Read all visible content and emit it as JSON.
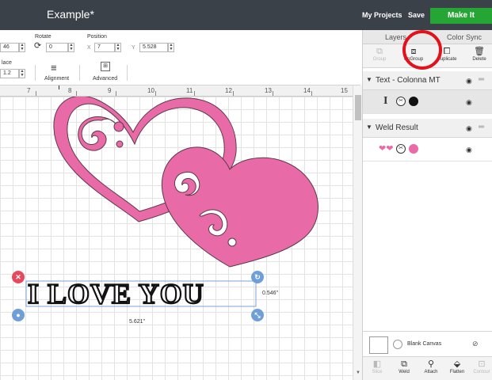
{
  "header": {
    "title": "Example*",
    "my_projects": "My Projects",
    "save": "Save",
    "make_it": "Make It"
  },
  "toolbar": {
    "size_value": "46",
    "rotate_label": "Rotate",
    "rotate_value": "0",
    "position_label": "Position",
    "x_label": "X",
    "x_value": "7",
    "y_label": "Y",
    "y_value": "5.528",
    "space_label": "lace",
    "space_value": "1.2",
    "alignment_label": "Alignment",
    "advanced_label": "Advanced"
  },
  "ruler": {
    "numbers": [
      "7",
      "8",
      "9",
      "10",
      "11",
      "12",
      "13",
      "14",
      "15"
    ]
  },
  "canvas": {
    "text_object": "I LOVE YOU",
    "height_dim": "0.546\"",
    "width_dim": "5.621\"",
    "art_color": "#e86aa6"
  },
  "panel": {
    "tab_layers": "Layers",
    "tab_color_sync": "Color Sync",
    "tools": {
      "group": "Group",
      "ungroup": "UnGroup",
      "duplicate": "Duplicate",
      "delete": "Delete"
    },
    "groups": [
      {
        "label": "Text - Colonna MT"
      },
      {
        "label": "Weld Result"
      }
    ],
    "blank_canvas": "Blank Canvas",
    "bottom_tools": {
      "slice": "Slice",
      "weld": "Weld",
      "attach": "Attach",
      "flatten": "Flatten",
      "contour": "Contour"
    }
  },
  "colors": {
    "make_it_green": "#25a533",
    "topbar": "#3b4148",
    "pink": "#e86aa6",
    "highlight_ring": "#e2111b",
    "handle_blue": "#6f9fd8",
    "handle_red": "#e8485b"
  }
}
